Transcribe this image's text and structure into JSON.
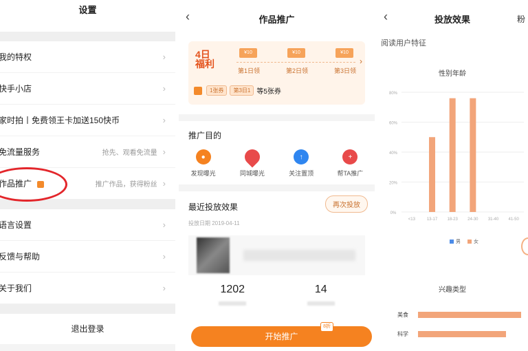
{
  "settings": {
    "title": "设置",
    "rows": [
      {
        "label": "我的特权",
        "value": ""
      },
      {
        "label": "快手小店",
        "value": ""
      },
      {
        "label": "家时拍丨免费领王卡加送150快币",
        "value": ""
      },
      {
        "label": "免流量服务",
        "value": "抢先、观看免流量"
      },
      {
        "label": "作品推广",
        "value": "推广作品，获得粉丝"
      },
      {
        "label": "语言设置",
        "value": ""
      },
      {
        "label": "反馈与帮助",
        "value": ""
      },
      {
        "label": "关于我们",
        "value": ""
      }
    ],
    "logout": "退出登录"
  },
  "promote": {
    "title": "作品推广",
    "bonus_title_1": "4日",
    "bonus_title_2": "福利",
    "coupons": [
      "¥10",
      "¥10",
      "¥10"
    ],
    "days": [
      "第1日领",
      "第2日领",
      "第3日领"
    ],
    "tags": [
      "1张券",
      "第3日1"
    ],
    "tags_suffix": "等5张券",
    "goal_section": "推广目的",
    "goals": [
      {
        "label": "发现曝光",
        "color": "#f58220",
        "icon": "flame-icon"
      },
      {
        "label": "同城曝光",
        "color": "#e84a4a",
        "icon": "location-icon"
      },
      {
        "label": "关注置顶",
        "color": "#2f86f0",
        "icon": "pin-icon"
      },
      {
        "label": "帮TA推广",
        "color": "#e84a4a",
        "icon": "user-add-icon"
      }
    ],
    "recent_title": "最近投放效果",
    "recent_date": "投放日期 2019-04-11",
    "again_button": "再次投放",
    "stats": [
      "1202",
      "14"
    ],
    "start_button": "开始推广",
    "start_badge": "8折"
  },
  "effects": {
    "title": "投放效果",
    "tab2": "粉",
    "subtitle": "阅读用户特征",
    "chart_title": "性别年龄",
    "legend": [
      "男",
      "女"
    ],
    "type_title": "兴趣类型",
    "hbars": [
      {
        "label": "美食",
        "value": 1.0
      },
      {
        "label": "科学",
        "value": 0.85
      }
    ]
  },
  "chart_data": {
    "type": "bar",
    "title": "性别年龄",
    "categories": [
      "<13",
      "13-17",
      "18-23",
      "24-30",
      "31-40",
      "41-50"
    ],
    "ylim": [
      0,
      80
    ],
    "yticks": [
      "0%",
      "20%",
      "40%",
      "60%",
      "80%"
    ],
    "series": [
      {
        "name": "男",
        "color": "#4c8ce8",
        "values": [
          0,
          0,
          0,
          0,
          0,
          0
        ]
      },
      {
        "name": "女",
        "color": "#f2a57a",
        "values": [
          0,
          50,
          76,
          76,
          0,
          0
        ]
      }
    ]
  }
}
